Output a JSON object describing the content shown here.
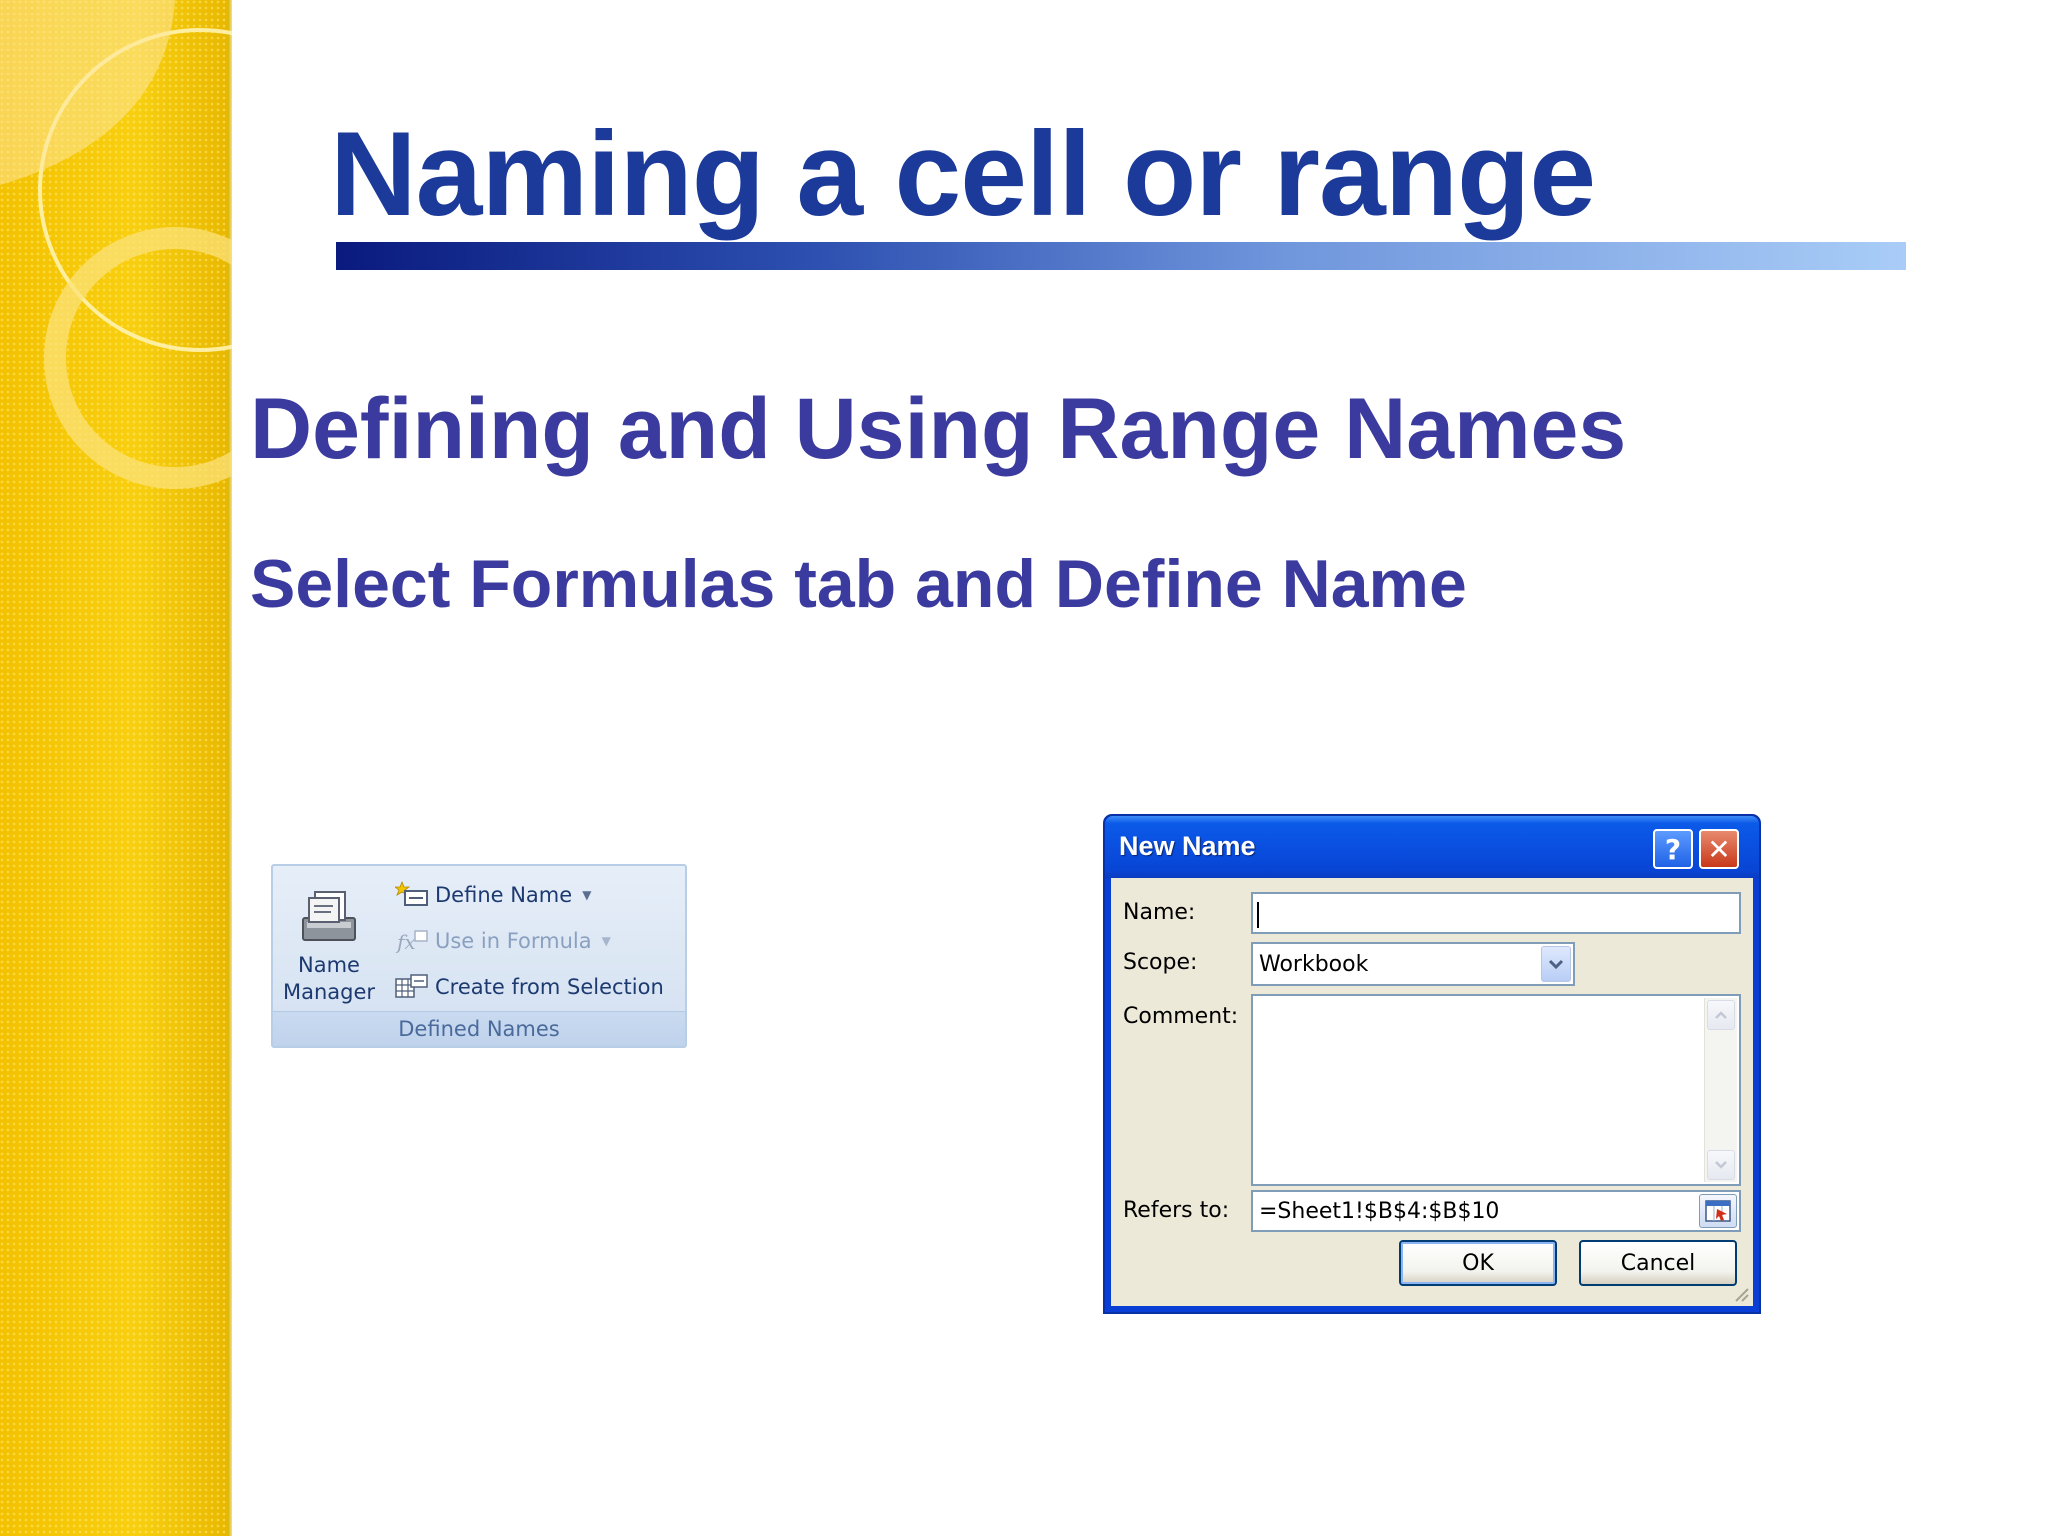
{
  "slide": {
    "title": "Naming a cell or range",
    "subtitle": "Defining and Using Range Names",
    "instruction": "Select Formulas tab and Define Name"
  },
  "ribbon": {
    "name_manager_label": "Name Manager",
    "define_name_label": "Define Name",
    "use_in_formula_label": "Use in Formula",
    "create_from_selection_label": "Create from Selection",
    "group_label": "Defined Names"
  },
  "dialog": {
    "title": "New Name",
    "help_label": "?",
    "close_label": "✕",
    "name_label": "Name:",
    "name_value": "",
    "scope_label": "Scope:",
    "scope_value": "Workbook",
    "comment_label": "Comment:",
    "comment_value": "",
    "refers_label": "Refers to:",
    "refers_value": "=Sheet1!$B$4:$B$10",
    "ok_label": "OK",
    "cancel_label": "Cancel"
  },
  "colors": {
    "band": "#f6c800",
    "title": "#1b3a99",
    "subtitle": "#3b3a9e",
    "dialog_titlebar": "#0a4fe0",
    "dialog_body": "#ece9d8"
  }
}
